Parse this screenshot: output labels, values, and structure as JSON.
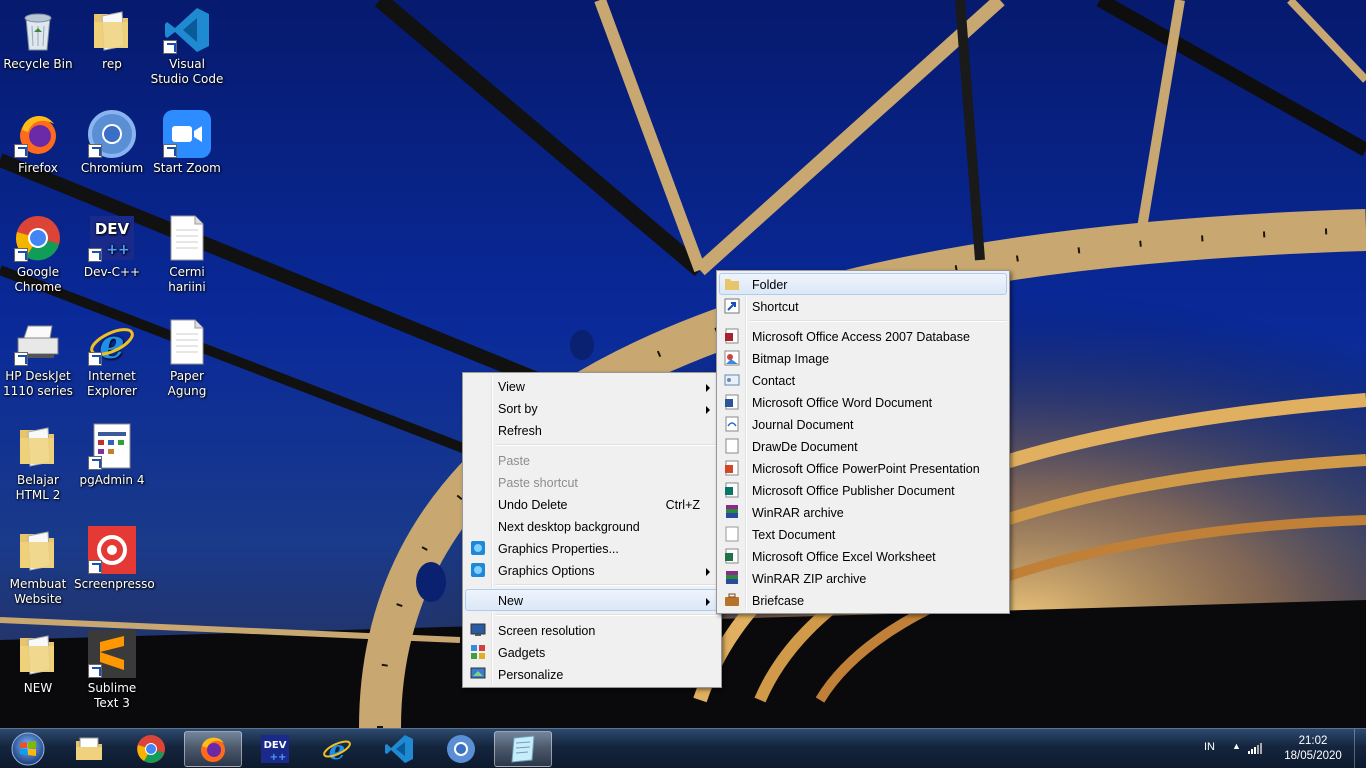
{
  "desktop_icons": [
    {
      "label": "Recycle Bin",
      "icon": "recycle-bin-icon"
    },
    {
      "label": "rep",
      "icon": "folder-icon"
    },
    {
      "label": "Visual Studio Code",
      "icon": "vscode-icon"
    },
    {
      "label": "Firefox",
      "icon": "firefox-icon"
    },
    {
      "label": "Chromium",
      "icon": "chromium-icon"
    },
    {
      "label": "Start Zoom",
      "icon": "zoom-icon"
    },
    {
      "label": "Google Chrome",
      "icon": "chrome-icon"
    },
    {
      "label": "Dev-C++",
      "icon": "devcpp-icon"
    },
    {
      "label": "Cermi hariini",
      "icon": "text-file-icon"
    },
    {
      "label": "HP DeskJet 1110 series",
      "icon": "printer-icon"
    },
    {
      "label": "Internet Explorer",
      "icon": "internet-explorer-icon"
    },
    {
      "label": "Paper Agung",
      "icon": "text-file-icon"
    },
    {
      "label": "Belajar HTML 2",
      "icon": "folder-icon"
    },
    {
      "label": "pgAdmin 4",
      "icon": "pgadmin-icon"
    },
    {
      "label": "Membuat Website",
      "icon": "folder-icon"
    },
    {
      "label": "Screenpresso",
      "icon": "screenpresso-icon"
    },
    {
      "label": "NEW",
      "icon": "folder-icon"
    },
    {
      "label": "Sublime Text 3",
      "icon": "sublime-text-icon"
    }
  ],
  "context_menu": {
    "view": "View",
    "sort_by": "Sort by",
    "refresh": "Refresh",
    "paste": "Paste",
    "paste_shortcut": "Paste shortcut",
    "undo_delete": "Undo Delete",
    "undo_delete_shortcut": "Ctrl+Z",
    "next_background": "Next desktop background",
    "graphics_properties": "Graphics Properties...",
    "graphics_options": "Graphics Options",
    "new": "New",
    "screen_resolution": "Screen resolution",
    "gadgets": "Gadgets",
    "personalize": "Personalize"
  },
  "new_submenu": {
    "folder": "Folder",
    "shortcut": "Shortcut",
    "items": [
      "Microsoft Office Access 2007 Database",
      "Bitmap Image",
      "Contact",
      "Microsoft Office Word Document",
      "Journal Document",
      "DrawDe Document",
      "Microsoft Office PowerPoint Presentation",
      "Microsoft Office Publisher Document",
      "WinRAR archive",
      "Text Document",
      "Microsoft Office Excel Worksheet",
      "WinRAR ZIP archive",
      "Briefcase"
    ]
  },
  "taskbar": {
    "pinned": [
      "file-explorer-icon",
      "chrome-icon",
      "firefox-icon",
      "devcpp-icon",
      "internet-explorer-icon",
      "vscode-icon",
      "chromium-icon",
      "notepad-icon"
    ],
    "active": "firefox-icon"
  },
  "tray": {
    "language": "IN",
    "time": "21:02",
    "date": "18/05/2020"
  }
}
